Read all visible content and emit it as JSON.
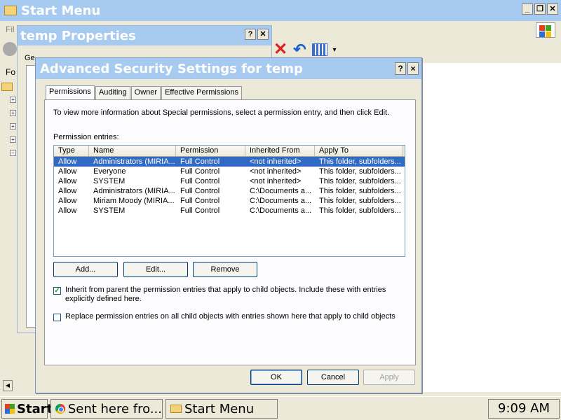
{
  "background_window": {
    "title": "Start Menu",
    "menu_partial": "Fil",
    "tree_partial": "Fo"
  },
  "properties_window": {
    "title": "temp Properties",
    "tab_partial": "Ge"
  },
  "dialog": {
    "title": "Advanced Security Settings for temp",
    "help_btn": "?",
    "close_btn": "×",
    "tabs": [
      {
        "label": "Permissions",
        "active": true
      },
      {
        "label": "Auditing",
        "active": false
      },
      {
        "label": "Owner",
        "active": false
      },
      {
        "label": "Effective Permissions",
        "active": false
      }
    ],
    "info_text": "To view more information about Special permissions, select a permission entry, and then click Edit.",
    "entries_label": "Permission entries:",
    "columns": [
      "Type",
      "Name",
      "Permission",
      "Inherited From",
      "Apply To"
    ],
    "rows": [
      {
        "type": "Allow",
        "name": "Administrators (MIRIA...",
        "permission": "Full Control",
        "inherited": "<not inherited>",
        "apply": "This folder, subfolders..."
      },
      {
        "type": "Allow",
        "name": "Everyone",
        "permission": "Full Control",
        "inherited": "<not inherited>",
        "apply": "This folder, subfolders..."
      },
      {
        "type": "Allow",
        "name": "SYSTEM",
        "permission": "Full Control",
        "inherited": "<not inherited>",
        "apply": "This folder, subfolders..."
      },
      {
        "type": "Allow",
        "name": "Administrators (MIRIA...",
        "permission": "Full Control",
        "inherited": "C:\\Documents a...",
        "apply": "This folder, subfolders..."
      },
      {
        "type": "Allow",
        "name": "Miriam Moody (MIRIA...",
        "permission": "Full Control",
        "inherited": "C:\\Documents a...",
        "apply": "This folder, subfolders..."
      },
      {
        "type": "Allow",
        "name": "SYSTEM",
        "permission": "Full Control",
        "inherited": "C:\\Documents a...",
        "apply": "This folder, subfolders..."
      }
    ],
    "buttons": {
      "add": "Add...",
      "edit": "Edit...",
      "remove": "Remove"
    },
    "inherit_checkbox": {
      "checked": true,
      "label": "Inherit from parent the permission entries that apply to child objects. Include these with entries explicitly defined here."
    },
    "replace_checkbox": {
      "checked": false,
      "label": "Replace permission entries on all child objects with entries shown here that apply to child objects"
    },
    "footer": {
      "ok": "OK",
      "cancel": "Cancel",
      "apply": "Apply"
    }
  },
  "taskbar": {
    "start": "Start",
    "tasks": [
      {
        "label": "Sent here fro...",
        "icon": "chrome-icon"
      },
      {
        "label": "Start Menu",
        "icon": "folder-icon"
      }
    ],
    "clock": "9:09 AM"
  }
}
